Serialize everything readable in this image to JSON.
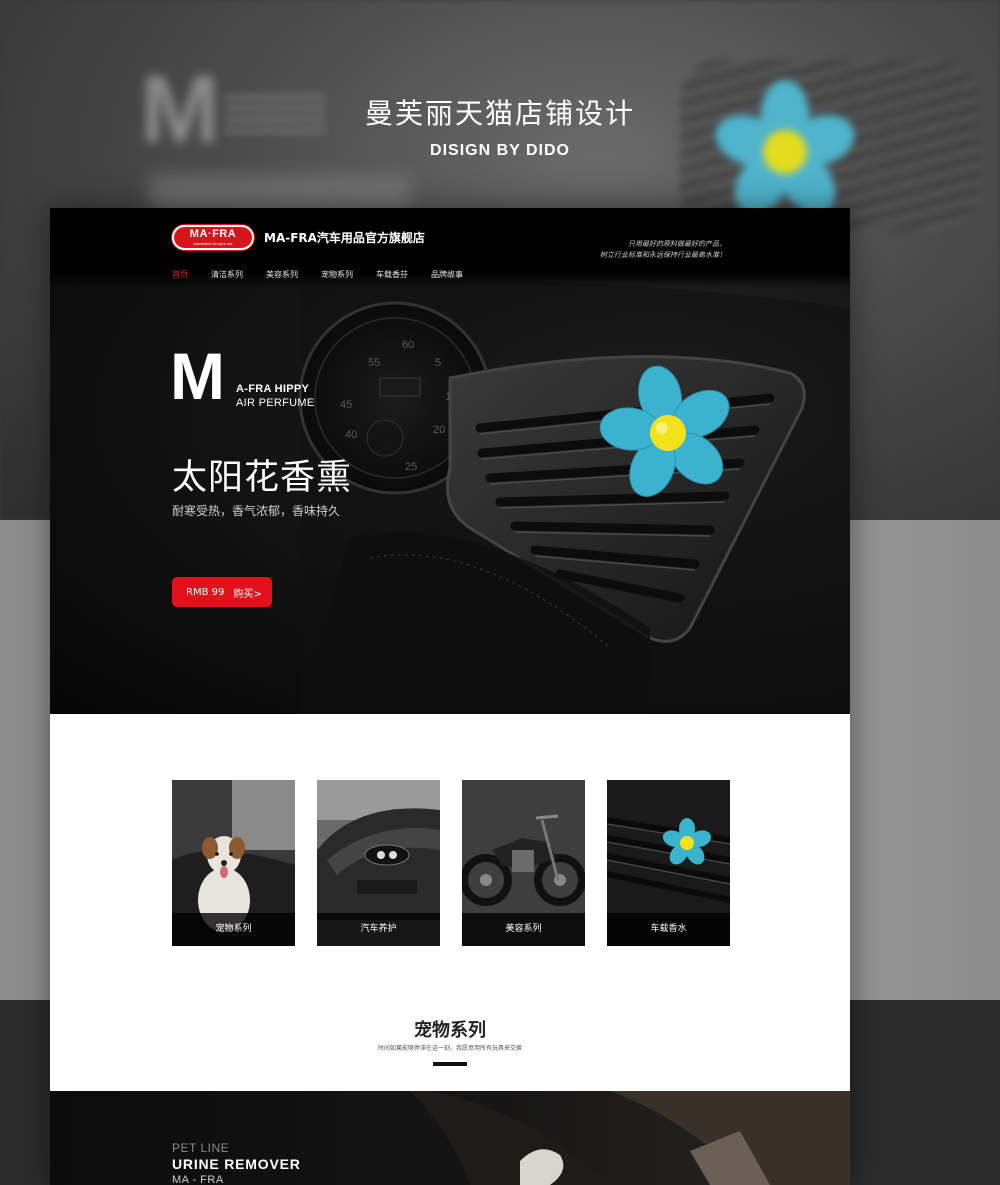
{
  "page": {
    "heading": "曼芙丽天猫店铺设计",
    "subheading": "DISIGN BY DIDO"
  },
  "header": {
    "logo_text": "MA·FRA",
    "logo_tagline": "cosmetics for your car",
    "store_name": "MA-FRA汽车用品官方旗舰店",
    "slogan_line1": "只用最好的原料做最好的产品，",
    "slogan_line2": "树立行业标准和永远保持行业最高水准！"
  },
  "nav": {
    "items": [
      {
        "label": "首页",
        "active": true
      },
      {
        "label": "清洁系列",
        "active": false
      },
      {
        "label": "美容系列",
        "active": false
      },
      {
        "label": "宠物系列",
        "active": false
      },
      {
        "label": "车载香芬",
        "active": false
      },
      {
        "label": "品牌故事",
        "active": false
      }
    ]
  },
  "hero": {
    "big_letter": "M",
    "line1": "A-FRA HIPPY",
    "line2": "AIR PERFUME",
    "title": "太阳花香熏",
    "subtitle": "耐寒受热，香气浓郁，香味持久",
    "price": "RMB 99",
    "buy_label": "购买>"
  },
  "categories": [
    {
      "label": "宠物系列",
      "icon": "dog-photo"
    },
    {
      "label": "汽车养护",
      "icon": "sports-car-photo"
    },
    {
      "label": "美容系列",
      "icon": "motorcycle-photo"
    },
    {
      "label": "车载香水",
      "icon": "flower-vent-photo"
    }
  ],
  "section": {
    "title": "宠物系列",
    "subtitle": "时间如果能够停滞在这一刻，我愿意用所有玩具来交换"
  },
  "banner": {
    "line1": "PET LINE",
    "line2": "URINE REMOVER",
    "line3": "MA - FRA"
  },
  "colors": {
    "accent_red": "#e2111b",
    "flower_blue": "#3bb3cf",
    "flower_center": "#f2e21a"
  }
}
